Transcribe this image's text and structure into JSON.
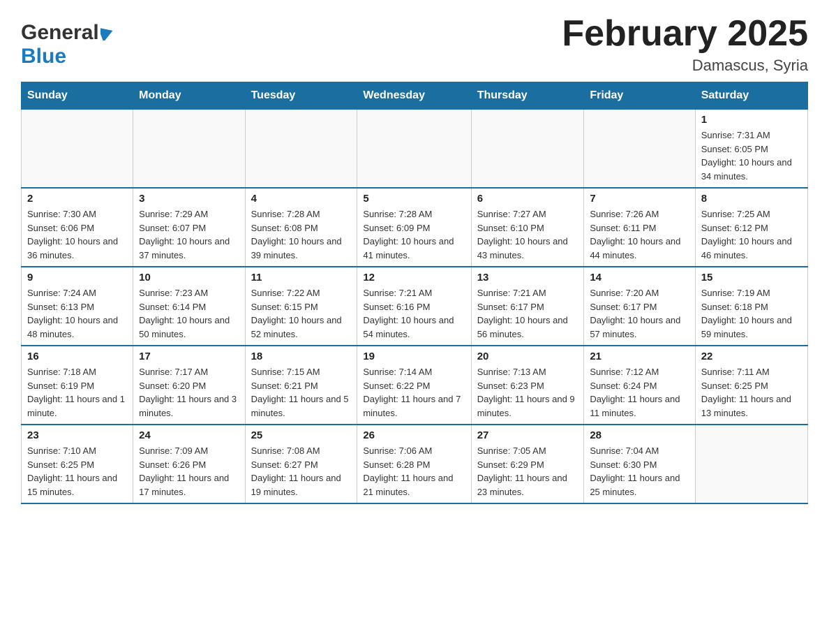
{
  "header": {
    "logo": {
      "general": "General",
      "blue": "Blue",
      "arrow_unicode": "▶"
    },
    "title": "February 2025",
    "subtitle": "Damascus, Syria"
  },
  "calendar": {
    "days_of_week": [
      "Sunday",
      "Monday",
      "Tuesday",
      "Wednesday",
      "Thursday",
      "Friday",
      "Saturday"
    ],
    "weeks": [
      [
        {
          "day": "",
          "info": ""
        },
        {
          "day": "",
          "info": ""
        },
        {
          "day": "",
          "info": ""
        },
        {
          "day": "",
          "info": ""
        },
        {
          "day": "",
          "info": ""
        },
        {
          "day": "",
          "info": ""
        },
        {
          "day": "1",
          "info": "Sunrise: 7:31 AM\nSunset: 6:05 PM\nDaylight: 10 hours and 34 minutes."
        }
      ],
      [
        {
          "day": "2",
          "info": "Sunrise: 7:30 AM\nSunset: 6:06 PM\nDaylight: 10 hours and 36 minutes."
        },
        {
          "day": "3",
          "info": "Sunrise: 7:29 AM\nSunset: 6:07 PM\nDaylight: 10 hours and 37 minutes."
        },
        {
          "day": "4",
          "info": "Sunrise: 7:28 AM\nSunset: 6:08 PM\nDaylight: 10 hours and 39 minutes."
        },
        {
          "day": "5",
          "info": "Sunrise: 7:28 AM\nSunset: 6:09 PM\nDaylight: 10 hours and 41 minutes."
        },
        {
          "day": "6",
          "info": "Sunrise: 7:27 AM\nSunset: 6:10 PM\nDaylight: 10 hours and 43 minutes."
        },
        {
          "day": "7",
          "info": "Sunrise: 7:26 AM\nSunset: 6:11 PM\nDaylight: 10 hours and 44 minutes."
        },
        {
          "day": "8",
          "info": "Sunrise: 7:25 AM\nSunset: 6:12 PM\nDaylight: 10 hours and 46 minutes."
        }
      ],
      [
        {
          "day": "9",
          "info": "Sunrise: 7:24 AM\nSunset: 6:13 PM\nDaylight: 10 hours and 48 minutes."
        },
        {
          "day": "10",
          "info": "Sunrise: 7:23 AM\nSunset: 6:14 PM\nDaylight: 10 hours and 50 minutes."
        },
        {
          "day": "11",
          "info": "Sunrise: 7:22 AM\nSunset: 6:15 PM\nDaylight: 10 hours and 52 minutes."
        },
        {
          "day": "12",
          "info": "Sunrise: 7:21 AM\nSunset: 6:16 PM\nDaylight: 10 hours and 54 minutes."
        },
        {
          "day": "13",
          "info": "Sunrise: 7:21 AM\nSunset: 6:17 PM\nDaylight: 10 hours and 56 minutes."
        },
        {
          "day": "14",
          "info": "Sunrise: 7:20 AM\nSunset: 6:17 PM\nDaylight: 10 hours and 57 minutes."
        },
        {
          "day": "15",
          "info": "Sunrise: 7:19 AM\nSunset: 6:18 PM\nDaylight: 10 hours and 59 minutes."
        }
      ],
      [
        {
          "day": "16",
          "info": "Sunrise: 7:18 AM\nSunset: 6:19 PM\nDaylight: 11 hours and 1 minute."
        },
        {
          "day": "17",
          "info": "Sunrise: 7:17 AM\nSunset: 6:20 PM\nDaylight: 11 hours and 3 minutes."
        },
        {
          "day": "18",
          "info": "Sunrise: 7:15 AM\nSunset: 6:21 PM\nDaylight: 11 hours and 5 minutes."
        },
        {
          "day": "19",
          "info": "Sunrise: 7:14 AM\nSunset: 6:22 PM\nDaylight: 11 hours and 7 minutes."
        },
        {
          "day": "20",
          "info": "Sunrise: 7:13 AM\nSunset: 6:23 PM\nDaylight: 11 hours and 9 minutes."
        },
        {
          "day": "21",
          "info": "Sunrise: 7:12 AM\nSunset: 6:24 PM\nDaylight: 11 hours and 11 minutes."
        },
        {
          "day": "22",
          "info": "Sunrise: 7:11 AM\nSunset: 6:25 PM\nDaylight: 11 hours and 13 minutes."
        }
      ],
      [
        {
          "day": "23",
          "info": "Sunrise: 7:10 AM\nSunset: 6:25 PM\nDaylight: 11 hours and 15 minutes."
        },
        {
          "day": "24",
          "info": "Sunrise: 7:09 AM\nSunset: 6:26 PM\nDaylight: 11 hours and 17 minutes."
        },
        {
          "day": "25",
          "info": "Sunrise: 7:08 AM\nSunset: 6:27 PM\nDaylight: 11 hours and 19 minutes."
        },
        {
          "day": "26",
          "info": "Sunrise: 7:06 AM\nSunset: 6:28 PM\nDaylight: 11 hours and 21 minutes."
        },
        {
          "day": "27",
          "info": "Sunrise: 7:05 AM\nSunset: 6:29 PM\nDaylight: 11 hours and 23 minutes."
        },
        {
          "day": "28",
          "info": "Sunrise: 7:04 AM\nSunset: 6:30 PM\nDaylight: 11 hours and 25 minutes."
        },
        {
          "day": "",
          "info": ""
        }
      ]
    ]
  }
}
